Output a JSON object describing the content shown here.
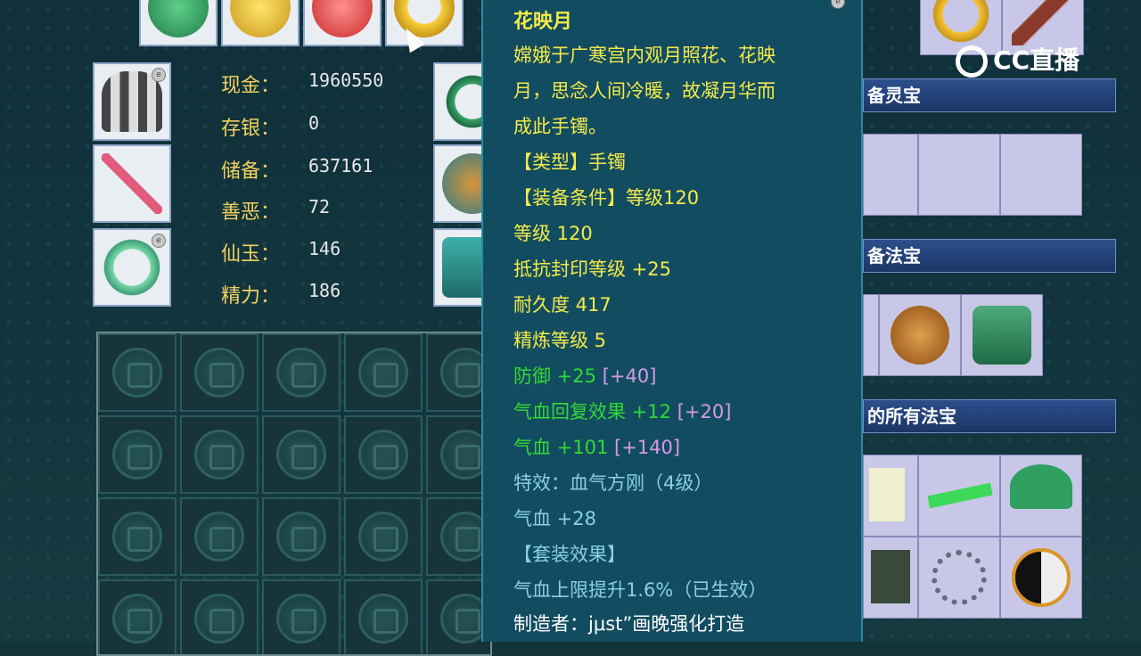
{
  "colors": {
    "gold": "#f0d060",
    "yellow_text": "#f4ea4a",
    "green_text": "#33d933",
    "light_blue": "#8ad0e0",
    "pink": "#d59ae8",
    "white": "#ffffff"
  },
  "top_items": [
    "green-jade-icon",
    "gold-nugget-icon",
    "red-gem-icon",
    "gold-bracelet-icon"
  ],
  "stats": [
    {
      "label": "现金：",
      "value": "1960550"
    },
    {
      "label": "存银：",
      "value": "0"
    },
    {
      "label": "储备：",
      "value": "637161"
    },
    {
      "label": "善恶：",
      "value": "72"
    },
    {
      "label": "仙玉：",
      "value": "146"
    },
    {
      "label": "精力：",
      "value": "186"
    }
  ],
  "tooltip": {
    "name": "花映月",
    "desc_lines": [
      "嫦娥于广寒宫内观月照花、花映",
      "月，思念人间冷暖，故凝月华而",
      "成此手镯。"
    ],
    "type_line": "【类型】手镯",
    "req_line": "【装备条件】等级120",
    "level": "等级 120",
    "resist": "抵抗封印等级 +25",
    "durability": "耐久度 417",
    "refine": "精炼等级 5",
    "defense": "防御 +25",
    "defense_bonus": "[+40]",
    "regen": "气血回复效果 +12",
    "regen_bonus": "[+20]",
    "hp": "气血 +101",
    "hp_bonus": "[+140]",
    "special": "特效：血气方刚（4级）",
    "hp2": "气血 +28",
    "set_title": "【套装效果】",
    "set_effect": "气血上限提升1.6%（已生效）",
    "maker": "制造者：jμst”画晚强化打造"
  },
  "banners": {
    "lingbao": "备灵宝",
    "fabao": "备法宝",
    "all_fabao": "的所有法宝"
  },
  "logo": {
    "text": "CC直播"
  }
}
